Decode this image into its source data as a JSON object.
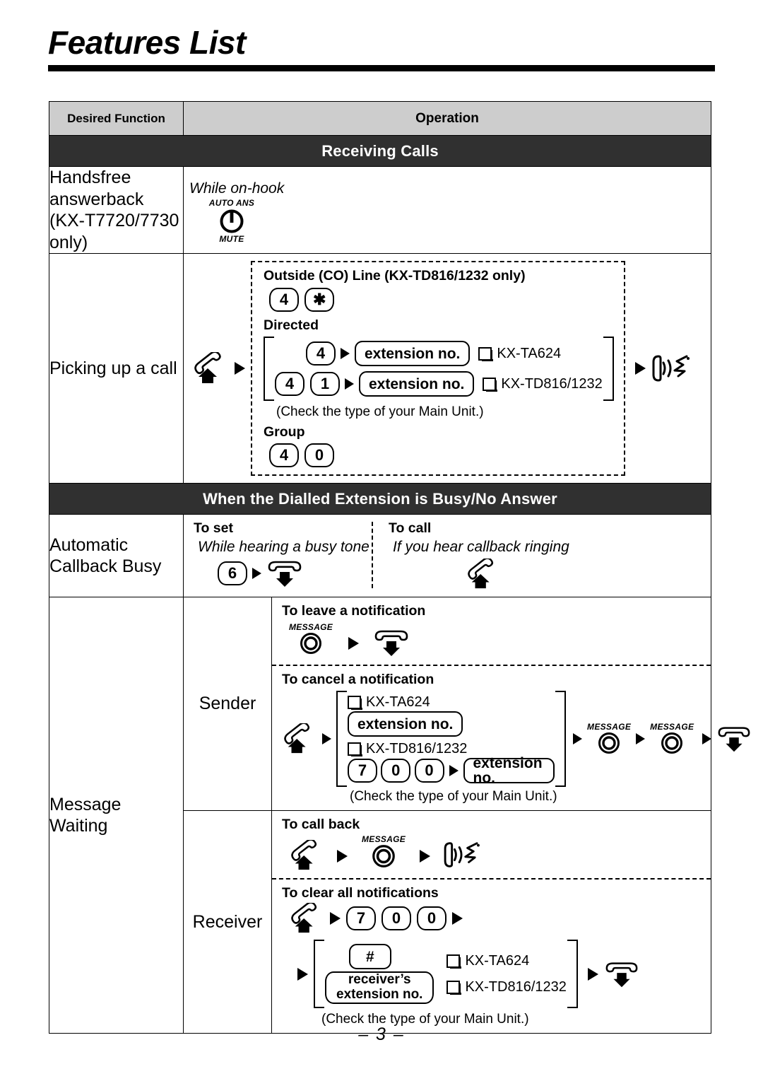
{
  "document": {
    "title": "Features List",
    "page_number": "– 3 –"
  },
  "table": {
    "headers": {
      "desired_function": "Desired Function",
      "operation": "Operation"
    },
    "section_bands": {
      "receiving_calls": "Receiving Calls",
      "busy_no_answer": "When the Dialled Extension is Busy/No Answer"
    },
    "rows": {
      "handsfree": {
        "function": "Handsfree answerback (KX-T7720/7730 only)",
        "condition": "While on-hook",
        "button_top_label": "AUTO ANS",
        "button_bottom_label": "MUTE"
      },
      "picking_up": {
        "function": "Picking up a call",
        "outside_line_heading": "Outside (CO) Line (KX-TD816/1232 only)",
        "outside_keys": [
          "4",
          "✱"
        ],
        "directed_heading": "Directed",
        "directed_row1_key": "4",
        "directed_row1_field": "extension no.",
        "directed_row1_unit": "KX-TA624",
        "directed_row2_keys": [
          "4",
          "1"
        ],
        "directed_row2_field": "extension no.",
        "directed_row2_unit": "KX-TD816/1232",
        "check_note": "(Check the type of your Main Unit.)",
        "group_heading": "Group",
        "group_keys": [
          "4",
          "0"
        ]
      },
      "callback_busy": {
        "function": "Automatic Callback Busy",
        "to_set_label": "To set",
        "to_set_condition": "While hearing a busy tone",
        "to_set_key": "6",
        "to_call_label": "To call",
        "to_call_condition": "If you hear callback ringing"
      },
      "message_waiting": {
        "function": "Message Waiting",
        "sender_label": "Sender",
        "receiver_label": "Receiver",
        "leave_heading": "To leave a notification",
        "message_button_label": "MESSAGE",
        "cancel_heading": "To cancel a notification",
        "cancel_unit_a": "KX-TA624",
        "cancel_field_a": "extension no.",
        "cancel_unit_b": "KX-TD816/1232",
        "cancel_keys_b": [
          "7",
          "0",
          "0"
        ],
        "cancel_field_b": "extension no.",
        "cancel_note": "(Check the type of your Main Unit.)",
        "callback_heading": "To call back",
        "clear_heading": "To clear all notifications",
        "clear_keys": [
          "7",
          "0",
          "0"
        ],
        "clear_hash_key": "#",
        "clear_field_line1": "receiver’s",
        "clear_field_line2": "extension no.",
        "clear_unit_a": "KX-TA624",
        "clear_unit_b": "KX-TD816/1232",
        "clear_note": "(Check the type of your Main Unit.)"
      }
    }
  },
  "icons": {
    "lift_handset": "lift-handset-icon",
    "hang_up": "hang-up-icon",
    "talking": "talking-handset-icon",
    "message_button": "message-button-icon",
    "auto_ans_mute_button": "auto-ans-mute-button-icon",
    "arrow": "arrow-right-icon"
  },
  "colors": {
    "band_background": "#303030",
    "header_background": "#cdcdcd",
    "text": "#000000"
  }
}
